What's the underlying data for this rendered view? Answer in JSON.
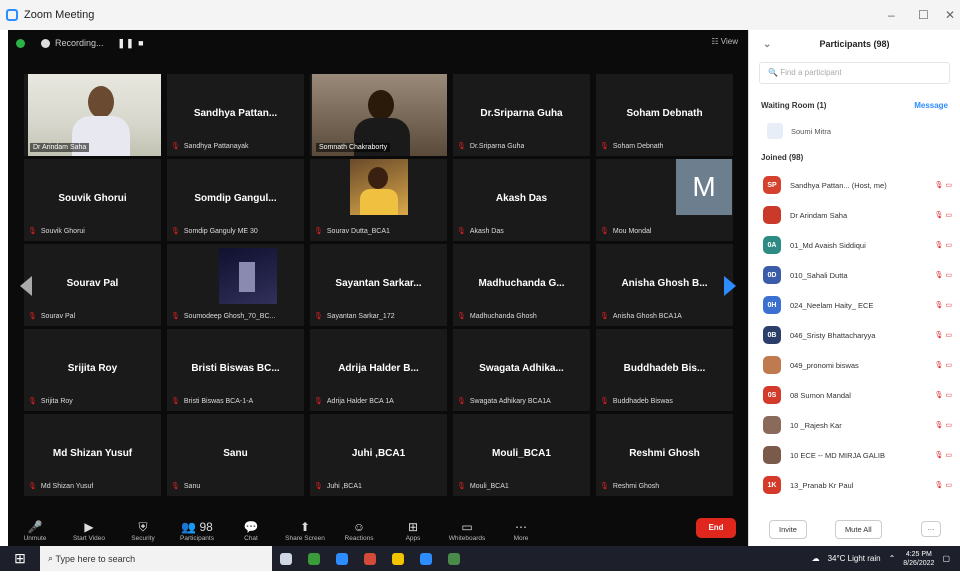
{
  "window": {
    "title": "Zoom Meeting",
    "controls": [
      "–",
      "☐",
      "✕"
    ]
  },
  "meeting": {
    "recording_label": "Recording...",
    "pause_label": "❚❚ ■",
    "view_label": "☷ View",
    "tiles": [
      {
        "name": "",
        "label": "Dr Arindam Saha",
        "video": "person1"
      },
      {
        "name": "Sandhya Pattan...",
        "label": "Sandhya Pattanayak"
      },
      {
        "name": "",
        "label": "Somnath Chakraborty",
        "video": "person2"
      },
      {
        "name": "Dr.Sriparna Guha",
        "label": "Dr.Sriparna Guha"
      },
      {
        "name": "Soham Debnath",
        "label": "Soham Debnath"
      },
      {
        "name": "Souvik Ghorui",
        "label": "Souvik Ghorui"
      },
      {
        "name": "Somdip Gangul...",
        "label": "Somdip Ganguly ME 30"
      },
      {
        "name": "",
        "label": "Sourav Dutta_BCA1",
        "thumb": "t1"
      },
      {
        "name": "Akash Das",
        "label": "Akash Das"
      },
      {
        "name": "",
        "label": "Mou Mondal",
        "avatar": "M"
      },
      {
        "name": "Sourav Pal",
        "label": "Sourav Pal"
      },
      {
        "name": "",
        "label": "Soumodeep Ghosh_70_BC...",
        "thumb": "t2"
      },
      {
        "name": "Sayantan Sarkar...",
        "label": "Sayantan Sarkar_172"
      },
      {
        "name": "Madhuchanda G...",
        "label": "Madhuchanda Ghosh"
      },
      {
        "name": "Anisha Ghosh B...",
        "label": "Anisha Ghosh BCA1A"
      },
      {
        "name": "Srijita Roy",
        "label": "Srijita Roy"
      },
      {
        "name": "Bristi Biswas BC...",
        "label": "Bristi Biswas BCA-1-A"
      },
      {
        "name": "Adrija Halder B...",
        "label": "Adrija Halder BCA 1A"
      },
      {
        "name": "Swagata Adhika...",
        "label": "Swagata Adhikary BCA1A"
      },
      {
        "name": "Buddhadeb Bis...",
        "label": "Buddhadeb Biswas"
      },
      {
        "name": "Md Shizan Yusuf",
        "label": "Md Shizan Yusuf"
      },
      {
        "name": "Sanu",
        "label": "Sanu"
      },
      {
        "name": "Juhi ,BCA1",
        "label": "Juhi ,BCA1"
      },
      {
        "name": "Mouli_BCA1",
        "label": "Mouli_BCA1"
      },
      {
        "name": "Reshmi Ghosh",
        "label": "Reshmi Ghosh"
      }
    ],
    "toolbar": [
      {
        "icon": "microphone-icon",
        "glyph": "🎤",
        "label": "Unmute"
      },
      {
        "icon": "video-icon",
        "glyph": "▶",
        "label": "Start Video"
      },
      {
        "icon": "security-icon",
        "glyph": "⛨",
        "label": "Security"
      },
      {
        "icon": "participants-icon",
        "glyph": "👥 98",
        "label": "Participants"
      },
      {
        "icon": "chat-icon",
        "glyph": "💬",
        "label": "Chat"
      },
      {
        "icon": "share-screen-icon",
        "glyph": "⬆",
        "label": "Share Screen"
      },
      {
        "icon": "reactions-icon",
        "glyph": "☺",
        "label": "Reactions"
      },
      {
        "icon": "apps-icon",
        "glyph": "⊞",
        "label": "Apps"
      },
      {
        "icon": "whiteboard-icon",
        "glyph": "▭",
        "label": "Whiteboards"
      },
      {
        "icon": "more-icon",
        "glyph": "⋯",
        "label": "More"
      }
    ],
    "end_label": "End"
  },
  "participants": {
    "header": "Participants (98)",
    "search_placeholder": "Find a participant",
    "waiting_room_label": "Waiting Room (1)",
    "message_label": "Message",
    "waiting": [
      "Soumi Mitra"
    ],
    "joined_label": "Joined (98)",
    "list": [
      {
        "initials": "SP",
        "color": "#d4412f",
        "name": "Sandhya Pattan... (Host, me)"
      },
      {
        "initials": "",
        "color": "#c93a2a",
        "name": "Dr Arindam Saha"
      },
      {
        "initials": "0A",
        "color": "#2e8b84",
        "name": "01_Md Avaish Siddiqui"
      },
      {
        "initials": "0D",
        "color": "#3b5ca8",
        "name": "010_Sahali Dutta"
      },
      {
        "initials": "0H",
        "color": "#3b6fd0",
        "name": "024_Neelam Haity_ ECE"
      },
      {
        "initials": "0B",
        "color": "#2b3f6a",
        "name": "046_Sristy Bhattacharyya"
      },
      {
        "initials": "",
        "color": "#c07a50",
        "name": "049_pronomi biswas"
      },
      {
        "initials": "0S",
        "color": "#d23b2b",
        "name": "08 Sumon Mandal"
      },
      {
        "initials": "",
        "color": "#8a6a5a",
        "name": "10 _Rajesh Kar"
      },
      {
        "initials": "",
        "color": "#7a5a4a",
        "name": "10 ECE -- MD MIRJA GALIB"
      },
      {
        "initials": "1K",
        "color": "#d43a2a",
        "name": "13_Pranab Kr Paul"
      }
    ],
    "invite_label": "Invite",
    "mute_all_label": "Mute All",
    "more_label": "..."
  },
  "taskbar": {
    "search_placeholder": "Type here to search",
    "weather": "34°C Light rain",
    "time": "4:25 PM",
    "date": "8/26/2022",
    "app_colors": [
      "#cfd8e4",
      "#3a9b3a",
      "#2d8cff",
      "#d24b3a",
      "#f2c400",
      "#2d8cff",
      "#4a8a4a"
    ]
  }
}
